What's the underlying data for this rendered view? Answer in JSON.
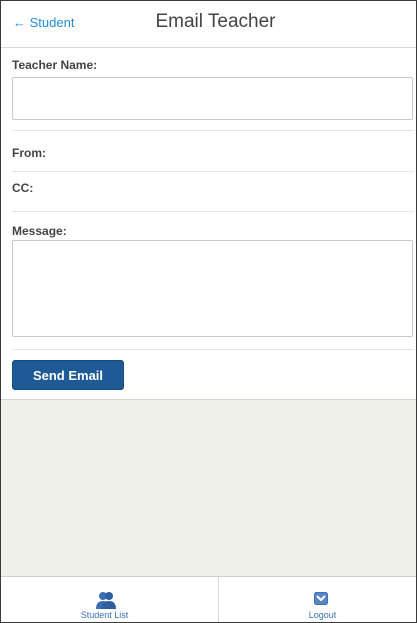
{
  "header": {
    "back_label": "← Student",
    "title": "Email Teacher"
  },
  "form": {
    "teacher_name_label": "Teacher Name:",
    "teacher_name_value": "",
    "from_label": "From:",
    "cc_label": "CC:",
    "message_label": "Message:",
    "message_value": "",
    "send_button_label": "Send Email"
  },
  "footer": {
    "tabs": [
      {
        "label": "Student List",
        "icon": "students-icon"
      },
      {
        "label": "Logout",
        "icon": "logout-chevron-icon"
      }
    ]
  },
  "colors": {
    "accent": "#1e5a96",
    "link": "#1f8fd6",
    "page_background": "#f1f1ec"
  }
}
